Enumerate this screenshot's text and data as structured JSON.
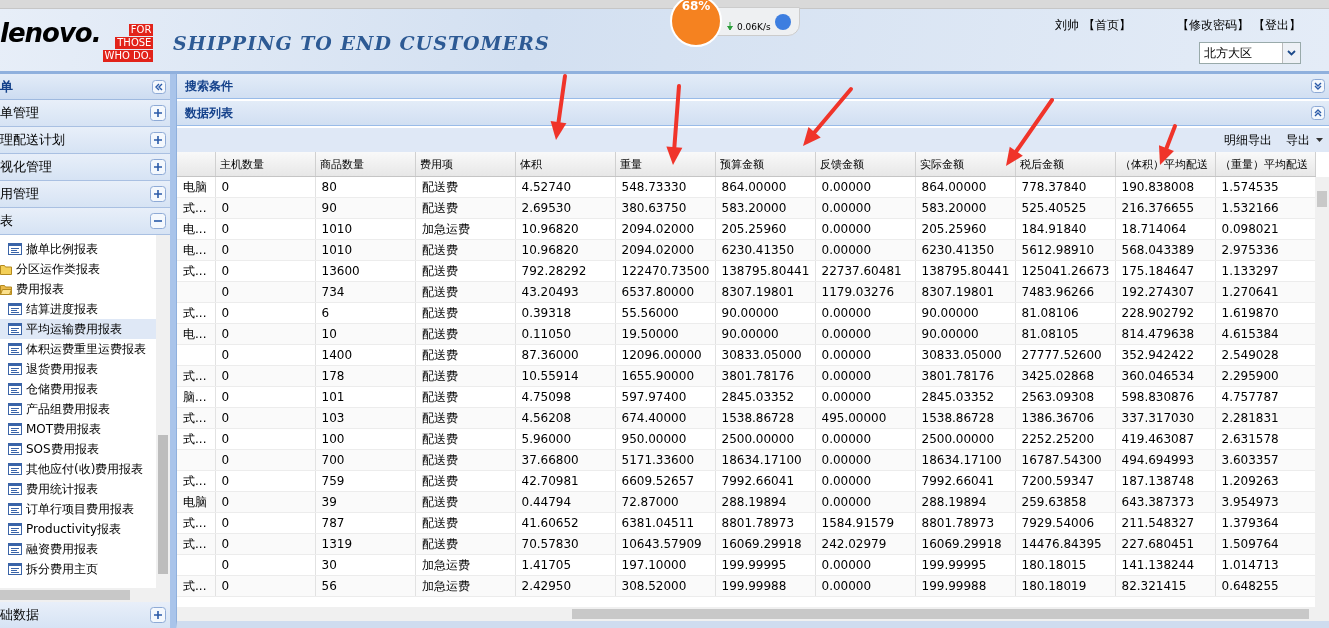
{
  "header": {
    "logo_word": "lenovo.",
    "logo_tag": [
      "FOR",
      "THOSE",
      "WHO DO."
    ],
    "title": "SHIPPING TO END CUSTOMERS",
    "user": "刘帅",
    "links": [
      "【首页】",
      "【修改密码】",
      "【登出】"
    ],
    "region_select": {
      "value": "北方大区"
    }
  },
  "speed_widget": {
    "percent": "68%",
    "rate": "0.06K/s"
  },
  "sidebar": {
    "title": "单",
    "sections": [
      {
        "label": "单管理",
        "expanded": false
      },
      {
        "label": "理配送计划",
        "expanded": false
      },
      {
        "label": "视化管理",
        "expanded": false
      },
      {
        "label": "用管理",
        "expanded": false
      },
      {
        "label": "表",
        "expanded": true,
        "tree": [
          {
            "label": "撤单比例报表",
            "kind": "report",
            "selected": false
          },
          {
            "label": "分区运作类报表",
            "kind": "folder",
            "expanded": false
          },
          {
            "label": "费用报表",
            "kind": "folder",
            "expanded": true,
            "children": [
              {
                "label": "结算进度报表",
                "kind": "report",
                "selected": false
              },
              {
                "label": "平均运输费用报表",
                "kind": "report",
                "selected": true
              },
              {
                "label": "体积运费重里运费报表",
                "kind": "report",
                "selected": false
              },
              {
                "label": "退货费用报表",
                "kind": "report",
                "selected": false
              },
              {
                "label": "仓储费用报表",
                "kind": "report",
                "selected": false
              },
              {
                "label": "产品组费用报表",
                "kind": "report",
                "selected": false
              },
              {
                "label": "MOT费用报表",
                "kind": "report",
                "selected": false
              },
              {
                "label": "SOS费用报表",
                "kind": "report",
                "selected": false
              },
              {
                "label": "其他应付(收)费用报表",
                "kind": "report",
                "selected": false
              },
              {
                "label": "费用统计报表",
                "kind": "report",
                "selected": false
              },
              {
                "label": "订单行项目费用报表",
                "kind": "report",
                "selected": false
              },
              {
                "label": "Productivity报表",
                "kind": "report",
                "selected": false
              },
              {
                "label": "融资费用报表",
                "kind": "report",
                "selected": false
              },
              {
                "label": "拆分费用主页",
                "kind": "report",
                "selected": false
              }
            ]
          }
        ]
      },
      {
        "label": "础数据",
        "expanded": false
      }
    ]
  },
  "panels": [
    {
      "title": "搜索条件",
      "expanded": false
    },
    {
      "title": "数据列表",
      "expanded": true
    }
  ],
  "toolbar": [
    {
      "label": "明细导出",
      "kind": "button"
    },
    {
      "label": "导出",
      "kind": "menu"
    }
  ],
  "table": {
    "columns": [
      "主机数量",
      "商品数量",
      "费用项",
      "体积",
      "重量",
      "预算金额",
      "反馈金额",
      "实际金额",
      "税后金额",
      "（体积）平均配送",
      "（重量）平均配送"
    ],
    "rows": [
      {
        "column_1": "电脑",
        "cells": [
          "0",
          "80",
          "配送费",
          "4.52740",
          "548.73330",
          "864.00000",
          "0.00000",
          "864.00000",
          "778.37840",
          "190.838008",
          "1.574535"
        ]
      },
      {
        "column_1": "式...",
        "cells": [
          "0",
          "90",
          "配送费",
          "2.69530",
          "380.63750",
          "583.20000",
          "0.00000",
          "583.20000",
          "525.40525",
          "216.376655",
          "1.532166"
        ]
      },
      {
        "column_1": "电...",
        "cells": [
          "0",
          "1010",
          "加急运费",
          "10.96820",
          "2094.02000",
          "205.25960",
          "0.00000",
          "205.25960",
          "184.91840",
          "18.714064",
          "0.098021"
        ]
      },
      {
        "column_1": "电...",
        "cells": [
          "0",
          "1010",
          "配送费",
          "10.96820",
          "2094.02000",
          "6230.41350",
          "0.00000",
          "6230.41350",
          "5612.98910",
          "568.043389",
          "2.975336"
        ]
      },
      {
        "column_1": "式...",
        "cells": [
          "0",
          "13600",
          "配送费",
          "792.28292",
          "122470.73500",
          "138795.80441",
          "22737.60481",
          "138795.80441",
          "125041.26673",
          "175.184647",
          "1.133297"
        ]
      },
      {
        "cells": [
          "0",
          "734",
          "配送费",
          "43.20493",
          "6537.80000",
          "8307.19801",
          "1179.03276",
          "8307.19801",
          "7483.96266",
          "192.274307",
          "1.270641"
        ]
      },
      {
        "column_1": "式...",
        "cells": [
          "0",
          "6",
          "配送费",
          "0.39318",
          "55.56000",
          "90.00000",
          "0.00000",
          "90.00000",
          "81.08106",
          "228.902792",
          "1.619870"
        ]
      },
      {
        "column_1": "电...",
        "cells": [
          "0",
          "10",
          "配送费",
          "0.11050",
          "19.50000",
          "90.00000",
          "0.00000",
          "90.00000",
          "81.08105",
          "814.479638",
          "4.615384"
        ]
      },
      {
        "cells": [
          "0",
          "1400",
          "配送费",
          "87.36000",
          "12096.00000",
          "30833.05000",
          "0.00000",
          "30833.05000",
          "27777.52600",
          "352.942422",
          "2.549028"
        ]
      },
      {
        "column_1": "式...",
        "cells": [
          "0",
          "178",
          "配送费",
          "10.55914",
          "1655.90000",
          "3801.78176",
          "0.00000",
          "3801.78176",
          "3425.02868",
          "360.046534",
          "2.295900"
        ]
      },
      {
        "column_1": "脑...",
        "cells": [
          "0",
          "101",
          "配送费",
          "4.75098",
          "597.97400",
          "2845.03352",
          "0.00000",
          "2845.03352",
          "2563.09308",
          "598.830876",
          "4.757787"
        ]
      },
      {
        "column_1": "式...",
        "cells": [
          "0",
          "103",
          "配送费",
          "4.56208",
          "674.40000",
          "1538.86728",
          "495.00000",
          "1538.86728",
          "1386.36706",
          "337.317030",
          "2.281831"
        ]
      },
      {
        "column_1": "式...",
        "cells": [
          "0",
          "100",
          "配送费",
          "5.96000",
          "950.00000",
          "2500.00000",
          "0.00000",
          "2500.00000",
          "2252.25200",
          "419.463087",
          "2.631578"
        ]
      },
      {
        "cells": [
          "0",
          "700",
          "配送费",
          "37.66800",
          "5171.33600",
          "18634.17100",
          "0.00000",
          "18634.17100",
          "16787.54300",
          "494.694993",
          "3.603357"
        ]
      },
      {
        "column_1": "式...",
        "cells": [
          "0",
          "759",
          "配送费",
          "42.70981",
          "6609.52657",
          "7992.66041",
          "0.00000",
          "7992.66041",
          "7200.59347",
          "187.138748",
          "1.209263"
        ]
      },
      {
        "column_1": "电脑",
        "cells": [
          "0",
          "39",
          "配送费",
          "0.44794",
          "72.87000",
          "288.19894",
          "0.00000",
          "288.19894",
          "259.63858",
          "643.387373",
          "3.954973"
        ]
      },
      {
        "column_1": "式...",
        "cells": [
          "0",
          "787",
          "配送费",
          "41.60652",
          "6381.04511",
          "8801.78973",
          "1584.91579",
          "8801.78973",
          "7929.54006",
          "211.548327",
          "1.379364"
        ]
      },
      {
        "column_1": "式...",
        "cells": [
          "0",
          "1319",
          "配送费",
          "70.57830",
          "10643.57909",
          "16069.29918",
          "242.02979",
          "16069.29918",
          "14476.84395",
          "227.680451",
          "1.509764"
        ]
      },
      {
        "cells": [
          "0",
          "30",
          "加急运费",
          "1.41705",
          "197.10000",
          "199.99995",
          "0.00000",
          "199.99995",
          "180.18015",
          "141.138244",
          "1.014713"
        ]
      },
      {
        "column_1": "式...",
        "cells": [
          "0",
          "56",
          "加急运费",
          "2.42950",
          "308.52000",
          "199.99988",
          "0.00000",
          "199.99988",
          "180.18019",
          "82.321415",
          "0.648255"
        ]
      }
    ]
  }
}
